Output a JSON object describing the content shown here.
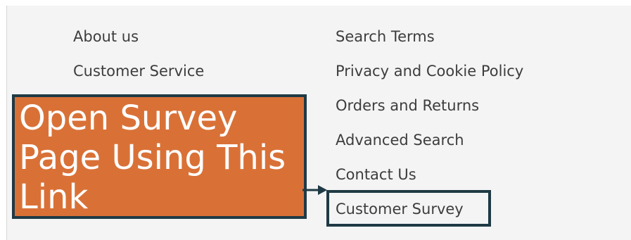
{
  "footer": {
    "left_links": [
      "About us",
      "Customer Service"
    ],
    "right_links": [
      "Search Terms",
      "Privacy and Cookie Policy",
      "Orders and Returns",
      "Advanced Search",
      "Contact Us",
      "Customer Survey"
    ]
  },
  "callout": {
    "lines": [
      "Open Survey",
      "Page Using This",
      "Link"
    ]
  },
  "colors": {
    "panel_background": "#f4f4f4",
    "callout_fill": "#d97137",
    "annotation_border": "#1f3a45",
    "link_text": "#3d3d3d"
  },
  "icons": [
    "arrow-right-icon"
  ]
}
